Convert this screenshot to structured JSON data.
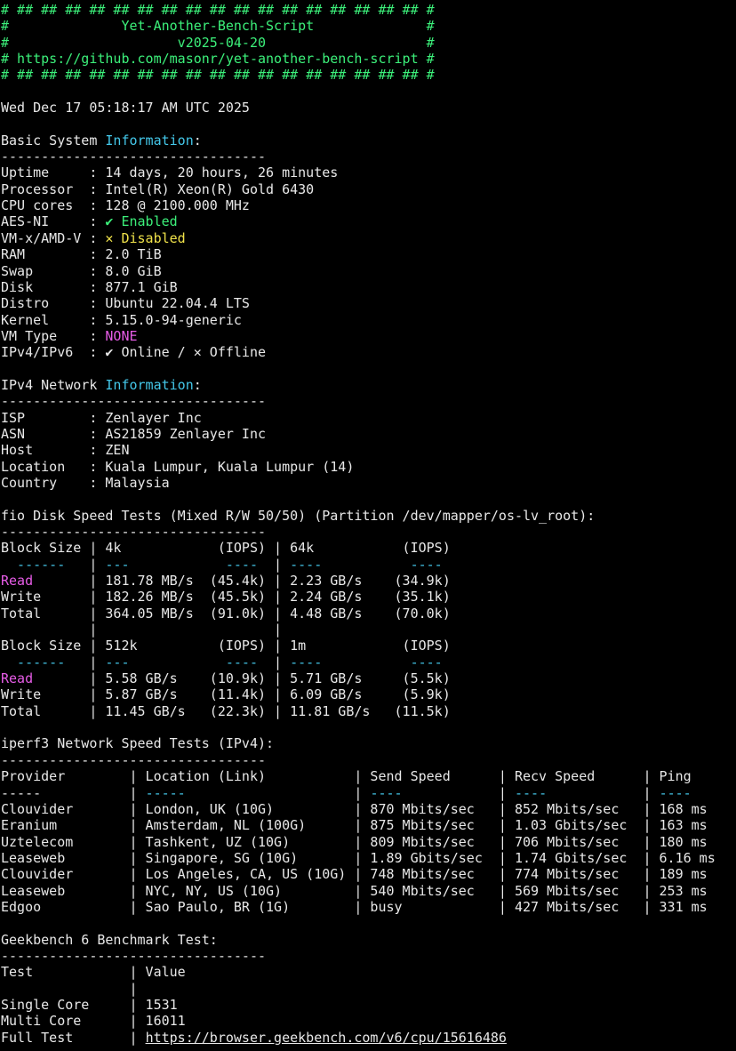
{
  "colors": {
    "background": "#000000",
    "text": "#e8e8e8",
    "header": "#3cf07a",
    "info_word": "#44c8ea",
    "enabled": "#3cf07a",
    "disabled": "#f0e24a",
    "highlight": "#e65ce6"
  },
  "lines": [
    {
      "name": "banner-line-1",
      "segs": [
        {
          "t": "# ## ## ## ## ## ## ## ## ## ## ## ## ## ## ## ## ## #",
          "c": "hdr"
        }
      ]
    },
    {
      "name": "banner-title",
      "segs": [
        {
          "t": "#              Yet-Another-Bench-Script              #",
          "c": "hdr"
        }
      ]
    },
    {
      "name": "banner-version",
      "segs": [
        {
          "t": "#                     v2025-04-20                    #",
          "c": "hdr"
        }
      ]
    },
    {
      "name": "banner-url",
      "segs": [
        {
          "t": "# https://github.com/masonr/yet-another-bench-script #",
          "c": "hdr"
        }
      ]
    },
    {
      "name": "banner-line-2",
      "segs": [
        {
          "t": "# ## ## ## ## ## ## ## ## ## ## ## ## ## ## ## ## ## #",
          "c": "hdr"
        }
      ]
    },
    {
      "name": "blank",
      "segs": []
    },
    {
      "name": "run-timestamp",
      "segs": [
        {
          "t": "Wed Dec 17 05:18:17 AM UTC 2025"
        }
      ]
    },
    {
      "name": "blank",
      "segs": []
    },
    {
      "name": "section-basic-system",
      "segs": [
        {
          "t": "Basic System "
        },
        {
          "t": "Information",
          "c": "info"
        },
        {
          "t": ":"
        }
      ]
    },
    {
      "name": "divider",
      "segs": [
        {
          "t": "---------------------------------"
        }
      ]
    },
    {
      "name": "row-uptime",
      "segs": [
        {
          "t": "Uptime     : 14 days, 20 hours, 26 minutes"
        }
      ]
    },
    {
      "name": "row-processor",
      "segs": [
        {
          "t": "Processor  : Intel(R) Xeon(R) Gold 6430"
        }
      ]
    },
    {
      "name": "row-cpu-cores",
      "segs": [
        {
          "t": "CPU cores  : 128 @ 2100.000 MHz"
        }
      ]
    },
    {
      "name": "row-aes-ni",
      "segs": [
        {
          "t": "AES-NI     : "
        },
        {
          "t": "✔ Enabled",
          "c": "ok"
        }
      ]
    },
    {
      "name": "row-vmx",
      "segs": [
        {
          "t": "VM-x/AMD-V : "
        },
        {
          "t": "✕ Disabled",
          "c": "warn"
        }
      ]
    },
    {
      "name": "row-ram",
      "segs": [
        {
          "t": "RAM        : 2.0 TiB"
        }
      ]
    },
    {
      "name": "row-swap",
      "segs": [
        {
          "t": "Swap       : 8.0 GiB"
        }
      ]
    },
    {
      "name": "row-disk",
      "segs": [
        {
          "t": "Disk       : 877.1 GiB"
        }
      ]
    },
    {
      "name": "row-distro",
      "segs": [
        {
          "t": "Distro     : Ubuntu 22.04.4 LTS"
        }
      ]
    },
    {
      "name": "row-kernel",
      "segs": [
        {
          "t": "Kernel     : 5.15.0-94-generic"
        }
      ]
    },
    {
      "name": "row-vm-type",
      "segs": [
        {
          "t": "VM Type    : "
        },
        {
          "t": "NONE",
          "c": "mag"
        }
      ]
    },
    {
      "name": "row-ipv4-ipv6",
      "segs": [
        {
          "t": "IPv4/IPv6  : ✔ Online / ✕ Offline"
        }
      ]
    },
    {
      "name": "blank",
      "segs": []
    },
    {
      "name": "section-ipv4-network",
      "segs": [
        {
          "t": "IPv4 Network "
        },
        {
          "t": "Information",
          "c": "info"
        },
        {
          "t": ":"
        }
      ]
    },
    {
      "name": "divider",
      "segs": [
        {
          "t": "---------------------------------"
        }
      ]
    },
    {
      "name": "row-isp",
      "segs": [
        {
          "t": "ISP        : Zenlayer Inc"
        }
      ]
    },
    {
      "name": "row-asn",
      "segs": [
        {
          "t": "ASN        : AS21859 Zenlayer Inc"
        }
      ]
    },
    {
      "name": "row-host",
      "segs": [
        {
          "t": "Host       : ZEN"
        }
      ]
    },
    {
      "name": "row-location",
      "segs": [
        {
          "t": "Location   : Kuala Lumpur, Kuala Lumpur (14)"
        }
      ]
    },
    {
      "name": "row-country",
      "segs": [
        {
          "t": "Country    : Malaysia"
        }
      ]
    },
    {
      "name": "blank",
      "segs": []
    },
    {
      "name": "section-fio",
      "segs": [
        {
          "t": "fio Disk Speed Tests (Mixed R/W 50/50) (Partition /dev/mapper/os-lv_root):"
        }
      ]
    },
    {
      "name": "divider",
      "segs": [
        {
          "t": "---------------------------------"
        }
      ]
    },
    {
      "name": "fio-header-1",
      "segs": [
        {
          "t": "Block Size | 4k            (IOPS) | 64k           (IOPS)"
        }
      ]
    },
    {
      "name": "fio-subrule-1",
      "segs": [
        {
          "t": "  ------",
          "c": "dash"
        },
        {
          "t": "   | "
        },
        {
          "t": "---            ----",
          "c": "dash"
        },
        {
          "t": "  | "
        },
        {
          "t": "----           ----",
          "c": "dash"
        }
      ]
    },
    {
      "name": "fio-read-1",
      "segs": [
        {
          "t": "Read",
          "c": "mag"
        },
        {
          "t": "       | 181.78 MB/s  (45.4k) | 2.23 GB/s    (34.9k)"
        }
      ]
    },
    {
      "name": "fio-write-1",
      "segs": [
        {
          "t": "Write      | 182.26 MB/s  (45.5k) | 2.24 GB/s    (35.1k)"
        }
      ]
    },
    {
      "name": "fio-total-1",
      "segs": [
        {
          "t": "Total      | 364.05 MB/s  (91.0k) | 4.48 GB/s    (70.0k)"
        }
      ]
    },
    {
      "name": "fio-spacer",
      "segs": [
        {
          "t": "           |                      |"
        }
      ]
    },
    {
      "name": "fio-header-2",
      "segs": [
        {
          "t": "Block Size | 512k          (IOPS) | 1m            (IOPS)"
        }
      ]
    },
    {
      "name": "fio-subrule-2",
      "segs": [
        {
          "t": "  ------",
          "c": "dash"
        },
        {
          "t": "   | "
        },
        {
          "t": "---            ----",
          "c": "dash"
        },
        {
          "t": "  | "
        },
        {
          "t": "----           ----",
          "c": "dash"
        }
      ]
    },
    {
      "name": "fio-read-2",
      "segs": [
        {
          "t": "Read",
          "c": "mag"
        },
        {
          "t": "       | 5.58 GB/s    (10.9k) | 5.71 GB/s     (5.5k)"
        }
      ]
    },
    {
      "name": "fio-write-2",
      "segs": [
        {
          "t": "Write      | 5.87 GB/s    (11.4k) | 6.09 GB/s     (5.9k)"
        }
      ]
    },
    {
      "name": "fio-total-2",
      "segs": [
        {
          "t": "Total      | 11.45 GB/s   (22.3k) | 11.81 GB/s   (11.5k)"
        }
      ]
    },
    {
      "name": "blank",
      "segs": []
    },
    {
      "name": "section-iperf3",
      "segs": [
        {
          "t": "iperf3 Network Speed Tests (IPv4):"
        }
      ]
    },
    {
      "name": "divider",
      "segs": [
        {
          "t": "---------------------------------"
        }
      ]
    },
    {
      "name": "iperf-header",
      "segs": [
        {
          "t": "Provider        | Location (Link)           | Send Speed      | Recv Speed      | Ping"
        }
      ]
    },
    {
      "name": "iperf-subrule",
      "segs": [
        {
          "t": "-----"
        },
        {
          "t": "           | "
        },
        {
          "t": "-----",
          "c": "dash"
        },
        {
          "t": "                     | "
        },
        {
          "t": "----",
          "c": "dash"
        },
        {
          "t": "            | "
        },
        {
          "t": "----",
          "c": "dash"
        },
        {
          "t": "            | "
        },
        {
          "t": "----",
          "c": "dash"
        }
      ]
    },
    {
      "name": "iperf-row",
      "segs": [
        {
          "t": "Clouvider       | London, UK (10G)          | 870 Mbits/sec   | 852 Mbits/sec   | 168 ms"
        }
      ]
    },
    {
      "name": "iperf-row",
      "segs": [
        {
          "t": "Eranium         | Amsterdam, NL (100G)      | 875 Mbits/sec   | 1.03 Gbits/sec  | 163 ms"
        }
      ]
    },
    {
      "name": "iperf-row",
      "segs": [
        {
          "t": "Uztelecom       | Tashkent, UZ (10G)        | 809 Mbits/sec   | 706 Mbits/sec   | 180 ms"
        }
      ]
    },
    {
      "name": "iperf-row",
      "segs": [
        {
          "t": "Leaseweb        | Singapore, SG (10G)       | 1.89 Gbits/sec  | 1.74 Gbits/sec  | 6.16 ms"
        }
      ]
    },
    {
      "name": "iperf-row",
      "segs": [
        {
          "t": "Clouvider       | Los Angeles, CA, US (10G) | 748 Mbits/sec   | 774 Mbits/sec   | 189 ms"
        }
      ]
    },
    {
      "name": "iperf-row",
      "segs": [
        {
          "t": "Leaseweb        | NYC, NY, US (10G)         | 540 Mbits/sec   | 569 Mbits/sec   | 253 ms"
        }
      ]
    },
    {
      "name": "iperf-row",
      "segs": [
        {
          "t": "Edgoo           | Sao Paulo, BR (1G)        | busy            | 427 Mbits/sec   | 331 ms"
        }
      ]
    },
    {
      "name": "blank",
      "segs": []
    },
    {
      "name": "section-geekbench",
      "segs": [
        {
          "t": "Geekbench 6 Benchmark Test:"
        }
      ]
    },
    {
      "name": "divider",
      "segs": [
        {
          "t": "---------------------------------"
        }
      ]
    },
    {
      "name": "geekbench-header",
      "segs": [
        {
          "t": "Test            | Value"
        }
      ]
    },
    {
      "name": "geekbench-spacer",
      "segs": [
        {
          "t": "                |"
        }
      ]
    },
    {
      "name": "geekbench-single-core",
      "segs": [
        {
          "t": "Single Core     | 1531"
        }
      ]
    },
    {
      "name": "geekbench-multi-core",
      "segs": [
        {
          "t": "Multi Core      | 16011"
        }
      ]
    },
    {
      "name": "geekbench-full-test",
      "segs": [
        {
          "t": "Full Test       | "
        },
        {
          "t": "https://browser.geekbench.com/v6/cpu/15616486",
          "c": "lnk"
        }
      ]
    }
  ]
}
